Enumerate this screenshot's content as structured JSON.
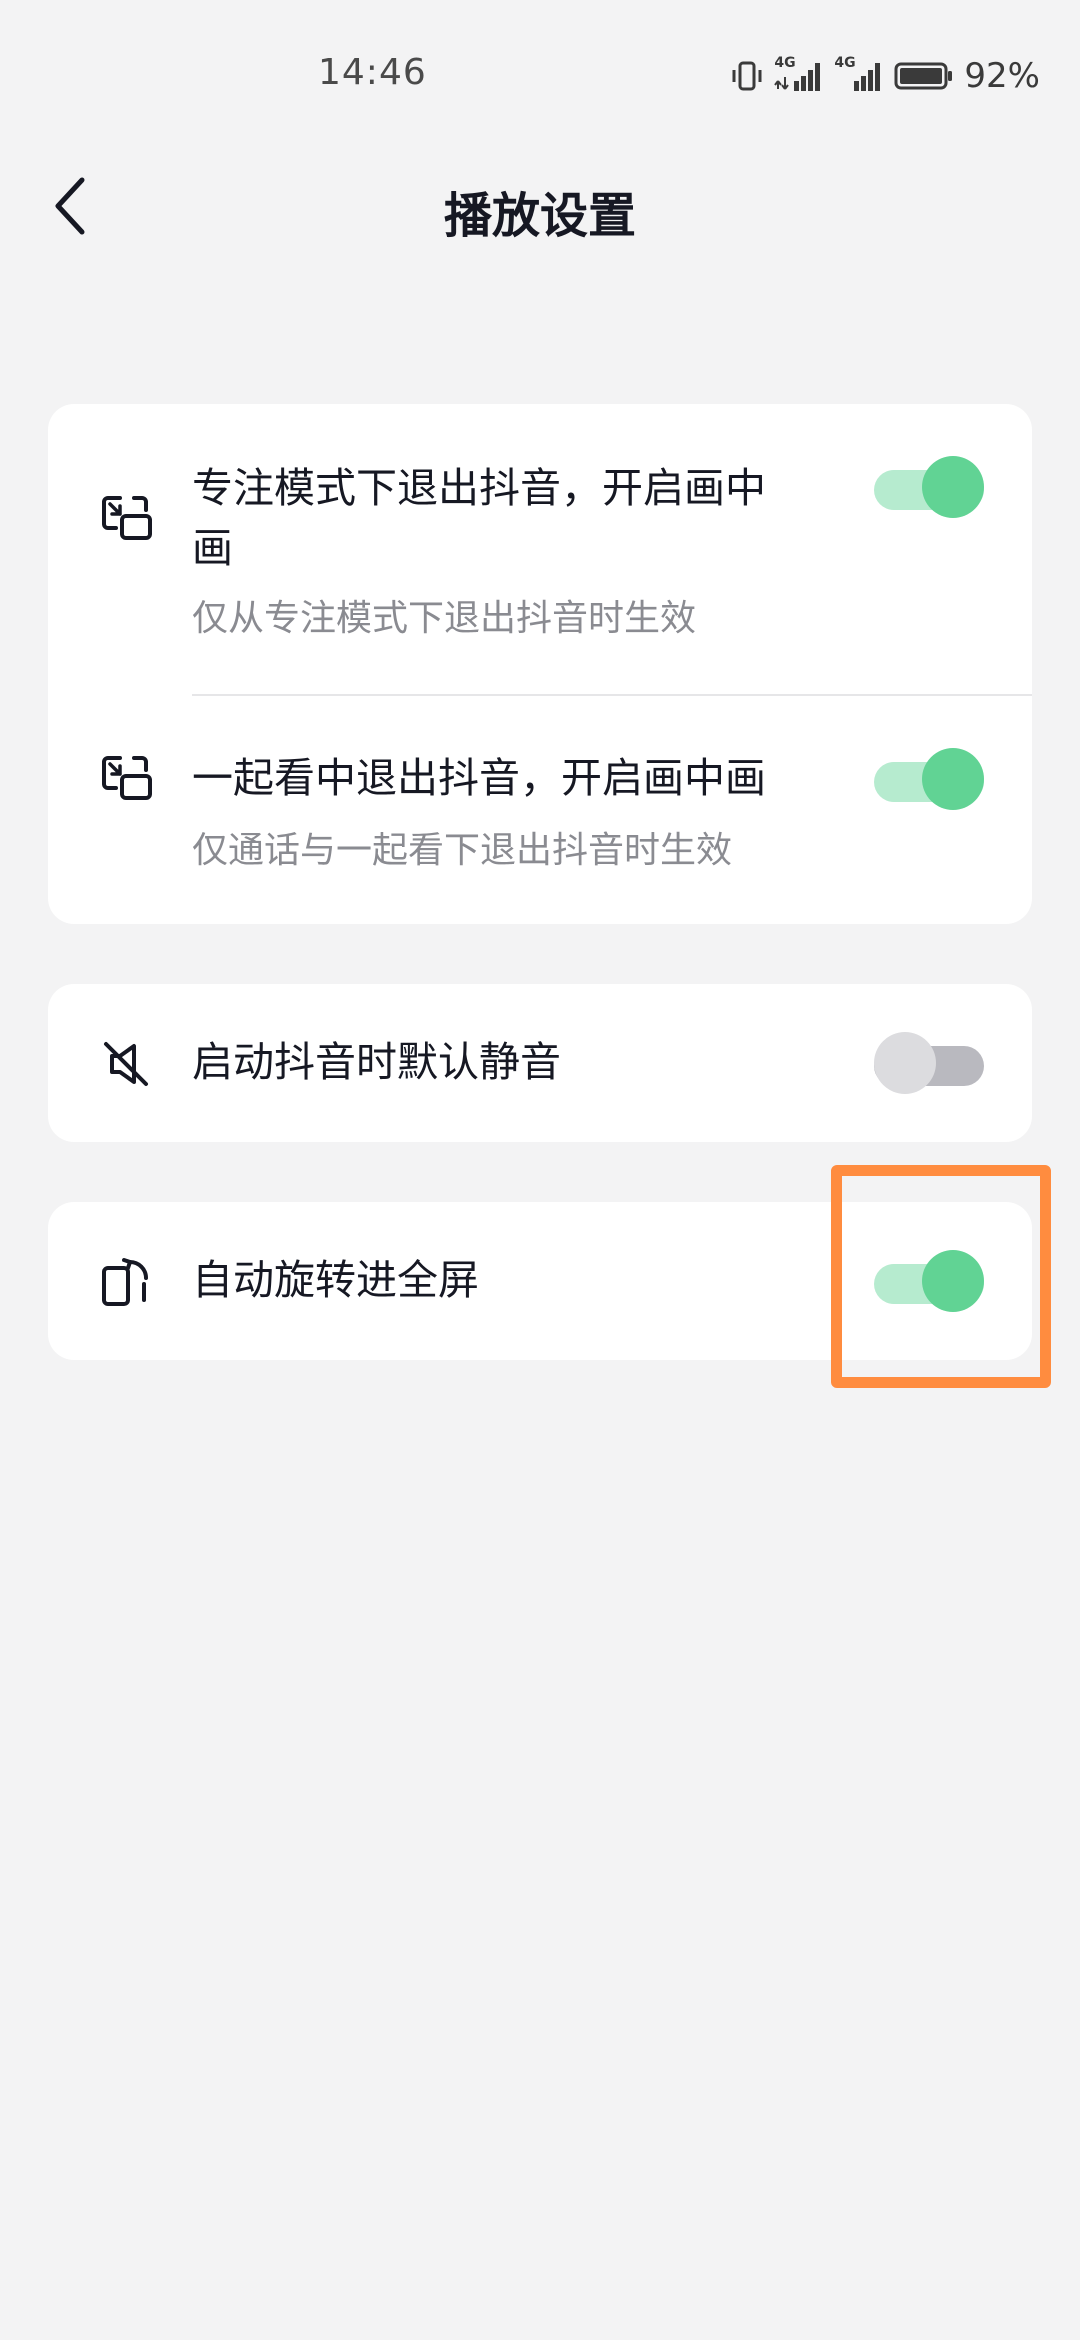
{
  "status_bar": {
    "time": "14:46",
    "battery_percent": "92%",
    "network_label_1": "4G",
    "network_label_2": "4G",
    "icons": [
      "vibrate-icon",
      "signal-4g-icon",
      "signal-4g-icon",
      "battery-icon"
    ]
  },
  "header": {
    "title": "播放设置",
    "back_icon": "chevron-left-icon"
  },
  "settings": {
    "pip_focus": {
      "title_line1": "专注模式下退出抖音，开启画中",
      "title_line2": "画",
      "subtitle": "仅从专注模式下退出抖音时生效",
      "enabled": true,
      "icon": "picture-in-picture-icon"
    },
    "pip_watch_together": {
      "title": "一起看中退出抖音，开启画中画",
      "subtitle": "仅通话与一起看下退出抖音时生效",
      "enabled": true,
      "icon": "picture-in-picture-icon"
    },
    "default_mute": {
      "title": "启动抖音时默认静音",
      "enabled": false,
      "icon": "mute-speaker-icon"
    },
    "auto_rotate": {
      "title": "自动旋转进全屏",
      "enabled": true,
      "icon": "rotate-screen-icon"
    }
  },
  "colors": {
    "background": "#f3f3f4",
    "card": "#ffffff",
    "toggle_on_knob": "#61d394",
    "toggle_on_track": "#b6ebcf",
    "toggle_off_knob": "#dcdcdf",
    "toggle_off_track": "#b9b9bf",
    "highlight": "#ff8c3f"
  }
}
